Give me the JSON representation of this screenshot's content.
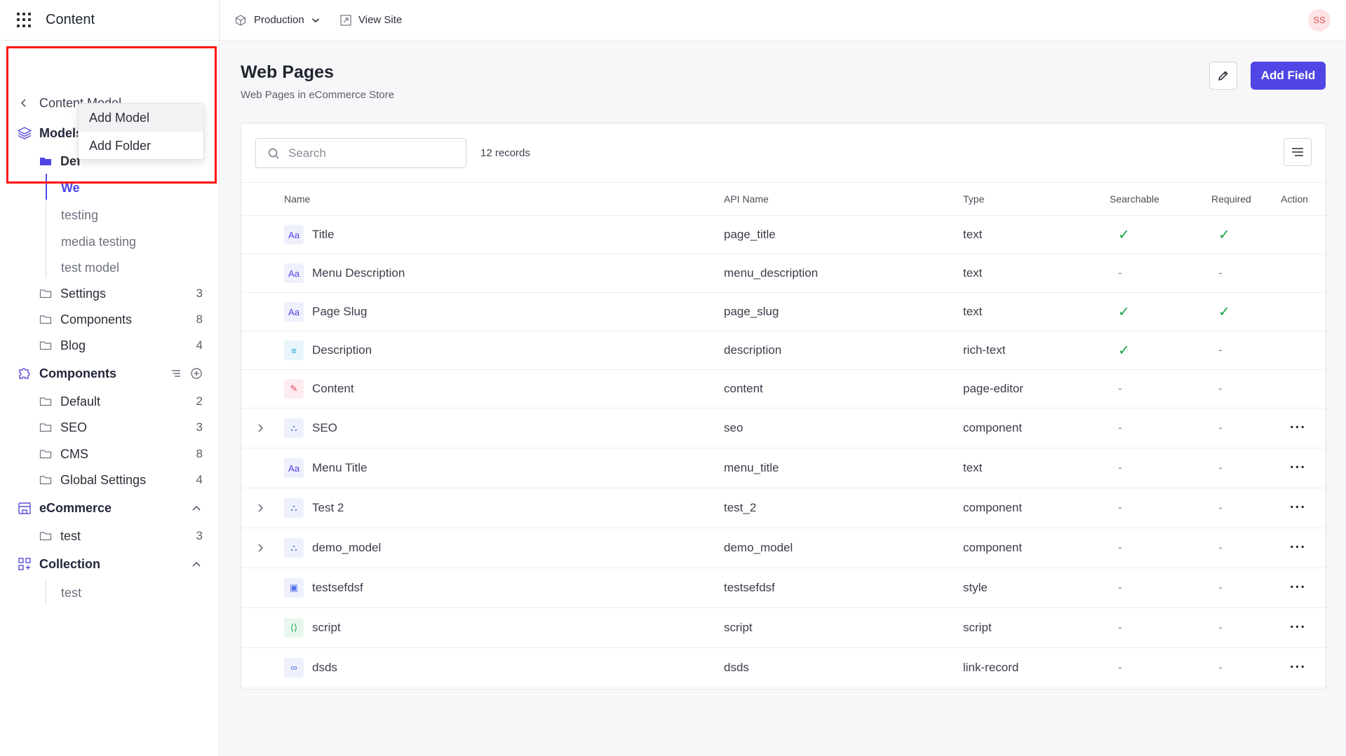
{
  "app": {
    "title": "Content"
  },
  "topbar": {
    "environment": "Production",
    "view_site": "View Site",
    "avatar": "SS"
  },
  "sidebar": {
    "back_label": "Content Model",
    "models": {
      "title": "Models",
      "folder_truncated": "Def",
      "active_item_truncated": "We",
      "items": [
        "testing",
        "media testing",
        "test model"
      ],
      "folders": [
        {
          "label": "Settings",
          "count": "3"
        },
        {
          "label": "Components",
          "count": "8"
        },
        {
          "label": "Blog",
          "count": "4"
        }
      ]
    },
    "components": {
      "title": "Components",
      "folders": [
        {
          "label": "Default",
          "count": "2"
        },
        {
          "label": "SEO",
          "count": "3"
        },
        {
          "label": "CMS",
          "count": "8"
        },
        {
          "label": "Global Settings",
          "count": "4"
        }
      ]
    },
    "ecommerce": {
      "title": "eCommerce",
      "folders": [
        {
          "label": "test",
          "count": "3"
        }
      ]
    },
    "collection": {
      "title": "Collection",
      "items": [
        "test"
      ]
    },
    "dropdown": {
      "add_model": "Add Model",
      "add_folder": "Add Folder"
    }
  },
  "page": {
    "title": "Web Pages",
    "subtitle": "Web Pages in eCommerce Store",
    "add_field": "Add Field",
    "search_placeholder": "Search",
    "records": "12 records"
  },
  "table": {
    "headers": {
      "name": "Name",
      "api": "API Name",
      "type": "Type",
      "searchable": "Searchable",
      "required": "Required",
      "action": "Action"
    },
    "rows": [
      {
        "name": "Title",
        "api": "page_title",
        "type": "text",
        "searchable": "✓",
        "required": "✓",
        "icon": "text-icon",
        "expand": false,
        "action": false
      },
      {
        "name": "Menu Description",
        "api": "menu_description",
        "type": "text",
        "searchable": "-",
        "required": "-",
        "icon": "text-icon",
        "expand": false,
        "action": false
      },
      {
        "name": "Page Slug",
        "api": "page_slug",
        "type": "text",
        "searchable": "✓",
        "required": "✓",
        "icon": "text-icon",
        "expand": false,
        "action": false
      },
      {
        "name": "Description",
        "api": "description",
        "type": "rich-text",
        "searchable": "✓",
        "required": "-",
        "icon": "rich-text-icon",
        "expand": false,
        "action": false
      },
      {
        "name": "Content",
        "api": "content",
        "type": "page-editor",
        "searchable": "-",
        "required": "-",
        "icon": "page-editor-icon",
        "expand": false,
        "action": false
      },
      {
        "name": "SEO",
        "api": "seo",
        "type": "component",
        "searchable": "-",
        "required": "-",
        "icon": "component-icon",
        "expand": true,
        "action": true
      },
      {
        "name": "Menu Title",
        "api": "menu_title",
        "type": "text",
        "searchable": "-",
        "required": "-",
        "icon": "text-icon",
        "expand": false,
        "action": true
      },
      {
        "name": "Test 2",
        "api": "test_2",
        "type": "component",
        "searchable": "-",
        "required": "-",
        "icon": "component-icon",
        "expand": true,
        "action": true
      },
      {
        "name": "demo_model",
        "api": "demo_model",
        "type": "component",
        "searchable": "-",
        "required": "-",
        "icon": "component-icon",
        "expand": true,
        "action": true
      },
      {
        "name": "testsefdsf",
        "api": "testsefdsf",
        "type": "style",
        "searchable": "-",
        "required": "-",
        "icon": "style-icon",
        "expand": false,
        "action": true
      },
      {
        "name": "script",
        "api": "script",
        "type": "script",
        "searchable": "-",
        "required": "-",
        "icon": "script-icon",
        "expand": false,
        "action": true
      },
      {
        "name": "dsds",
        "api": "dsds",
        "type": "link-record",
        "searchable": "-",
        "required": "-",
        "icon": "link-icon",
        "expand": false,
        "action": true
      }
    ]
  },
  "colors": {
    "accent": "#4f46e5",
    "check": "#16a34a",
    "highlight": "#ff1515"
  }
}
